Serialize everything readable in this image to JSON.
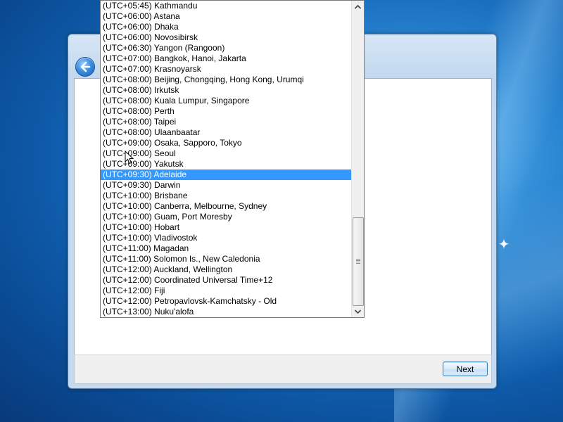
{
  "dialog": {
    "next_label": "Next"
  },
  "icons": {
    "back": "back-arrow-icon",
    "scroll_up": "chevron-up-icon",
    "scroll_down": "chevron-down-icon",
    "cursor": "mouse-pointer-icon",
    "windows_logo": "windows-logo-icon"
  },
  "colors": {
    "selection": "#3399ff",
    "desktop": "#1163b4"
  },
  "timezone_list": {
    "selected_index": 16,
    "items": [
      "(UTC+05:45) Kathmandu",
      "(UTC+06:00) Astana",
      "(UTC+06:00) Dhaka",
      "(UTC+06:00) Novosibirsk",
      "(UTC+06:30) Yangon (Rangoon)",
      "(UTC+07:00) Bangkok, Hanoi, Jakarta",
      "(UTC+07:00) Krasnoyarsk",
      "(UTC+08:00) Beijing, Chongqing, Hong Kong, Urumqi",
      "(UTC+08:00) Irkutsk",
      "(UTC+08:00) Kuala Lumpur, Singapore",
      "(UTC+08:00) Perth",
      "(UTC+08:00) Taipei",
      "(UTC+08:00) Ulaanbaatar",
      "(UTC+09:00) Osaka, Sapporo, Tokyo",
      "(UTC+09:00) Seoul",
      "(UTC+09:00) Yakutsk",
      "(UTC+09:30) Adelaide",
      "(UTC+09:30) Darwin",
      "(UTC+10:00) Brisbane",
      "(UTC+10:00) Canberra, Melbourne, Sydney",
      "(UTC+10:00) Guam, Port Moresby",
      "(UTC+10:00) Hobart",
      "(UTC+10:00) Vladivostok",
      "(UTC+11:00) Magadan",
      "(UTC+11:00) Solomon Is., New Caledonia",
      "(UTC+12:00) Auckland, Wellington",
      "(UTC+12:00) Coordinated Universal Time+12",
      "(UTC+12:00) Fiji",
      "(UTC+12:00) Petropavlovsk-Kamchatsky - Old",
      "(UTC+13:00) Nuku'alofa"
    ]
  }
}
